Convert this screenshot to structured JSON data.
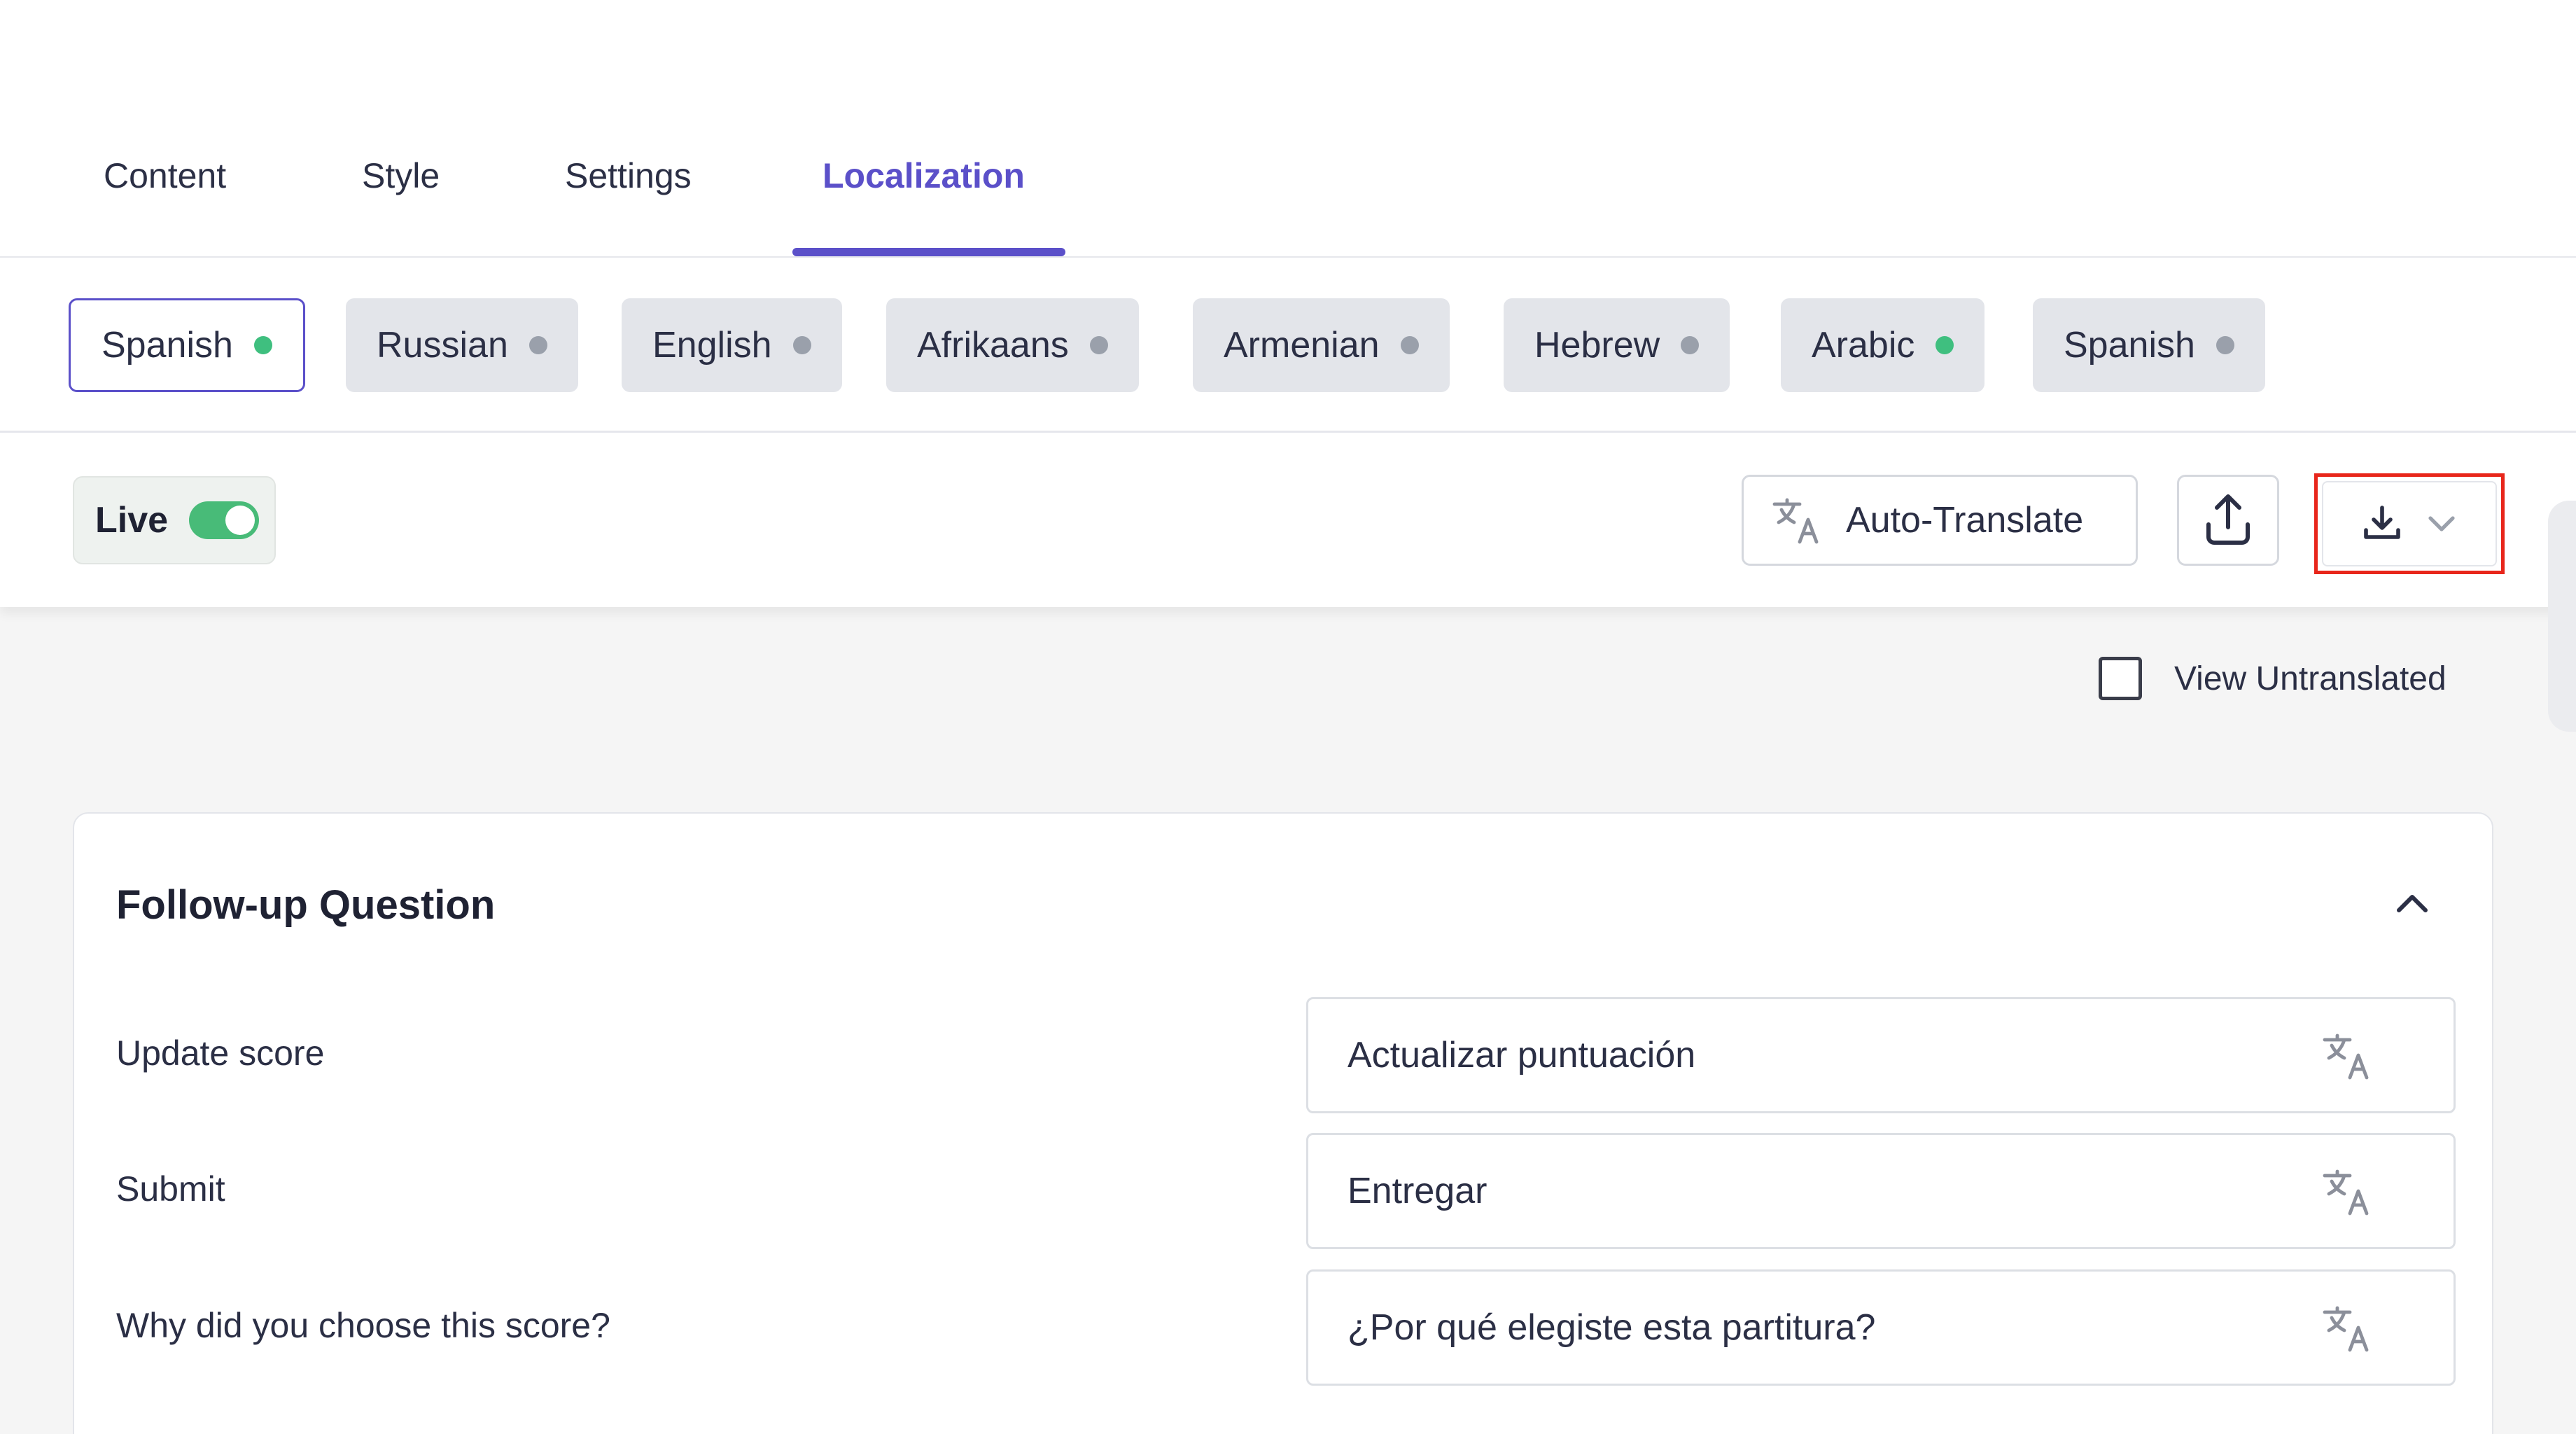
{
  "tabs": [
    {
      "label": "Content"
    },
    {
      "label": "Style"
    },
    {
      "label": "Settings"
    },
    {
      "label": "Localization",
      "active": true
    }
  ],
  "languages": [
    {
      "label": "Spanish",
      "status": "translated",
      "selected": true
    },
    {
      "label": "Russian",
      "status": "pending"
    },
    {
      "label": "English",
      "status": "pending"
    },
    {
      "label": "Afrikaans",
      "status": "pending"
    },
    {
      "label": "Armenian",
      "status": "pending"
    },
    {
      "label": "Hebrew",
      "status": "pending"
    },
    {
      "label": "Arabic",
      "status": "translated"
    },
    {
      "label": "Spanish",
      "status": "pending"
    }
  ],
  "toolbar": {
    "live_label": "Live",
    "live_on": true,
    "auto_translate_label": "Auto-Translate"
  },
  "view_untranslated": {
    "label": "View Untranslated",
    "checked": false
  },
  "section": {
    "title": "Follow-up Question",
    "rows": [
      {
        "source": "Update score",
        "translation": "Actualizar puntuación"
      },
      {
        "source": "Submit",
        "translation": "Entregar"
      },
      {
        "source": "Why did you choose this score?",
        "translation": "¿Por qué elegiste esta partitura?"
      }
    ]
  },
  "colors": {
    "accent": "#5b50c9",
    "status_translated": "#3fbf7f",
    "status_pending": "#9aa0ab",
    "toggle_on": "#48bb78",
    "highlight": "#e8261b"
  },
  "icons": {
    "translate": "translate-icon",
    "upload": "upload-icon",
    "download": "download-icon",
    "chevron_down": "chevron-down-icon",
    "chevron_up": "chevron-up-icon"
  }
}
